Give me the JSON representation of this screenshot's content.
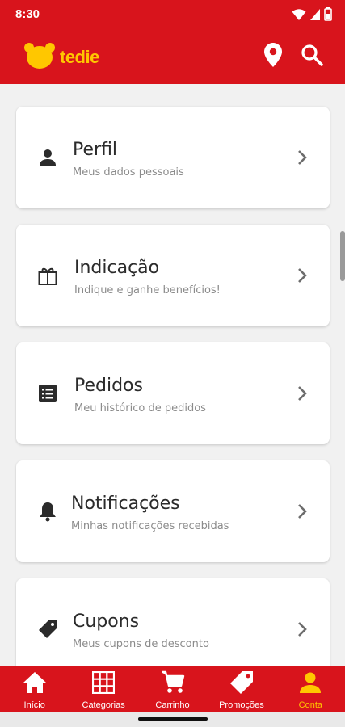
{
  "status_bar": {
    "time": "8:30"
  },
  "app": {
    "logo_text": "tedie",
    "brand_color": "#d8141c",
    "accent_color": "#ffc700"
  },
  "app_bar": {
    "actions": [
      {
        "icon": "location-pin-icon"
      },
      {
        "icon": "search-icon"
      }
    ]
  },
  "menu": [
    {
      "title": "Perfil",
      "subtitle": "Meus dados pessoais",
      "icon": "person-icon"
    },
    {
      "title": "Indicação",
      "subtitle": "Indique e ganhe benefícios!",
      "icon": "gift-icon"
    },
    {
      "title": "Pedidos",
      "subtitle": "Meu histórico de pedidos",
      "icon": "list-icon"
    },
    {
      "title": "Notificações",
      "subtitle": "Minhas notificações recebidas",
      "icon": "bell-icon"
    },
    {
      "title": "Cupons",
      "subtitle": "Meus cupons de desconto",
      "icon": "tag-icon"
    }
  ],
  "bottom_nav": [
    {
      "label": "Início",
      "icon": "home-icon"
    },
    {
      "label": "Categorias",
      "icon": "grid-icon"
    },
    {
      "label": "Carrinho",
      "icon": "cart-icon"
    },
    {
      "label": "Promoções",
      "icon": "tag-icon"
    },
    {
      "label": "Conta",
      "icon": "person-icon",
      "active": true
    }
  ]
}
